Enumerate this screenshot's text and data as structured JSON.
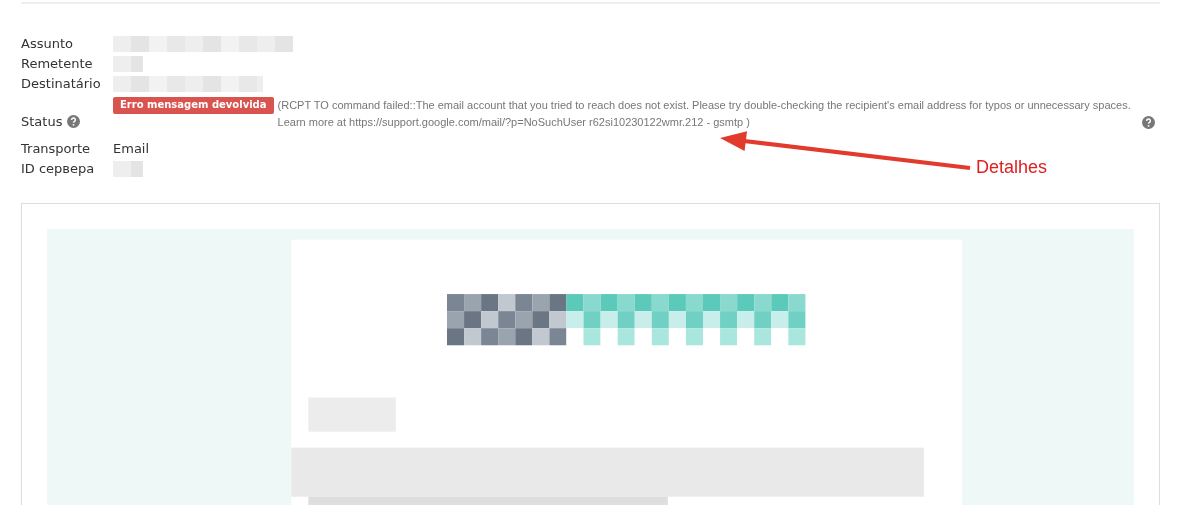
{
  "fields": [
    {
      "label": "Assunto",
      "kind": "redacted"
    },
    {
      "label": "Remetente",
      "kind": "redacted"
    },
    {
      "label": "Destinatário",
      "kind": "redacted"
    },
    {
      "label": "Status",
      "kind": "status",
      "badge": "Erro mensagem devolvida",
      "details": "(RCPT TO command failed::The email account that you tried to reach does not exist. Please try double-checking the recipient's email address for typos or unnecessary spaces. Learn more at https://support.google.com/mail/?p=NoSuchUser r62si10230122wmr.212 - gsmtp )"
    },
    {
      "label": "Transporte",
      "kind": "text",
      "value": "Email"
    },
    {
      "label": "ID сервера",
      "kind": "redacted"
    }
  ],
  "annotation": {
    "label": "Detalhes"
  }
}
